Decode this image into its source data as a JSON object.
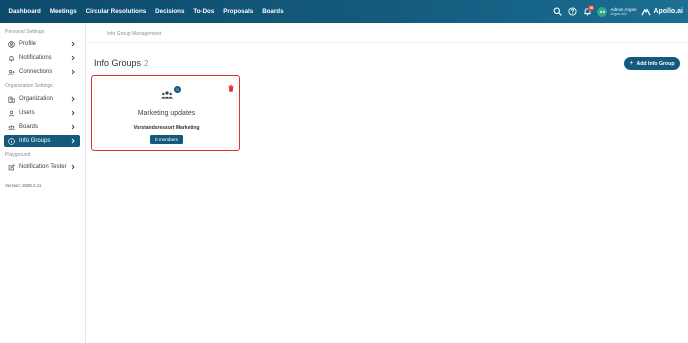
{
  "topnav": {
    "items": [
      {
        "label": "Dashboard"
      },
      {
        "label": "Meetings"
      },
      {
        "label": "Circular Resolutions"
      },
      {
        "label": "Decisions"
      },
      {
        "label": "To-Dos"
      },
      {
        "label": "Proposals"
      },
      {
        "label": "Boards"
      }
    ],
    "notification_count": "56",
    "avatar_initials": "AA",
    "user_name": "Admin Argos",
    "user_org": "Argos AG",
    "brand": "Apollo.ai",
    "accent": "#135a7d"
  },
  "sidebar": {
    "section_personal": "Personal Settings",
    "section_org": "Organization Settings",
    "section_playground": "Playground",
    "items": [
      {
        "label": "Profile",
        "icon": "user-circle-icon"
      },
      {
        "label": "Notifications",
        "icon": "bell-icon"
      },
      {
        "label": "Connections",
        "icon": "user-plus-icon"
      },
      {
        "label": "Organization",
        "icon": "building-icon"
      },
      {
        "label": "Users",
        "icon": "user-icon"
      },
      {
        "label": "Boards",
        "icon": "users-icon"
      },
      {
        "label": "Info Groups",
        "icon": "info-icon"
      },
      {
        "label": "Notification Tester",
        "icon": "edit-icon"
      }
    ],
    "version": "Version: 2025.2.11"
  },
  "main": {
    "breadcrumb": "Info Group Management",
    "title": "Info Groups",
    "count": "2",
    "add_button": "Add Info Group",
    "card": {
      "badge": "0",
      "title": "Marketing updates",
      "subtitle": "Vorstandsressort Marketing",
      "members": "0 members",
      "border_color": "#e0302c"
    }
  }
}
